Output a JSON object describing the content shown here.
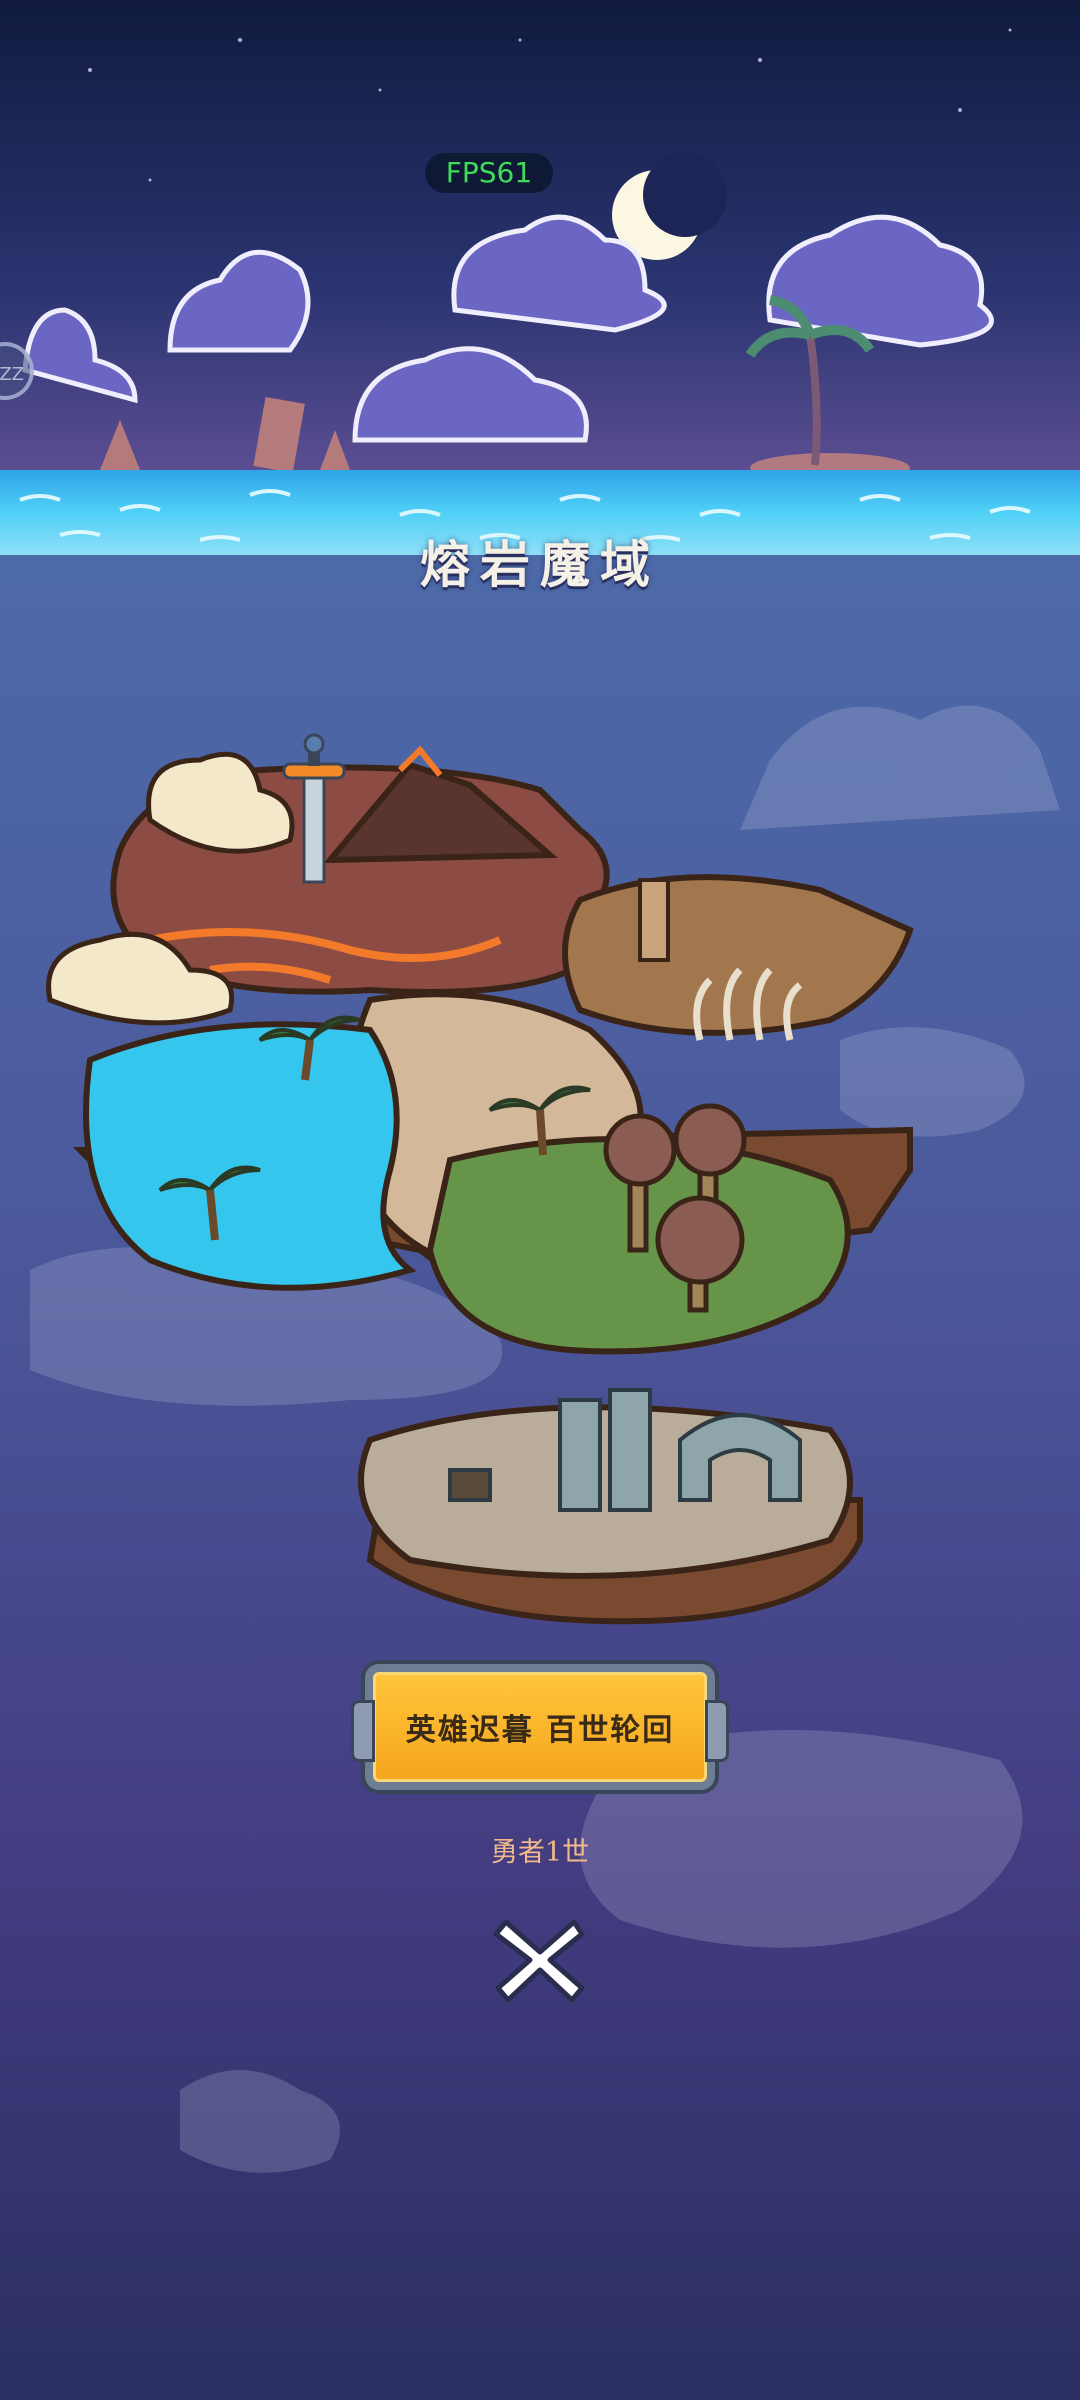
{
  "hud": {
    "fps": "FPS61"
  },
  "side_handle": {
    "label": "ZZ"
  },
  "region": {
    "title": "熔岩魔域"
  },
  "banner": {
    "label": "英雄迟暮 百世轮回"
  },
  "subtitle": "勇者1世",
  "close": {
    "icon": "close-icon"
  },
  "colors": {
    "sky_top": "#1b2050",
    "sea": "#35b9f0",
    "banner": "#f9b42a",
    "title": "#f5f1e6",
    "subtitle": "#f2b98a",
    "fps": "#3fdc5a"
  }
}
